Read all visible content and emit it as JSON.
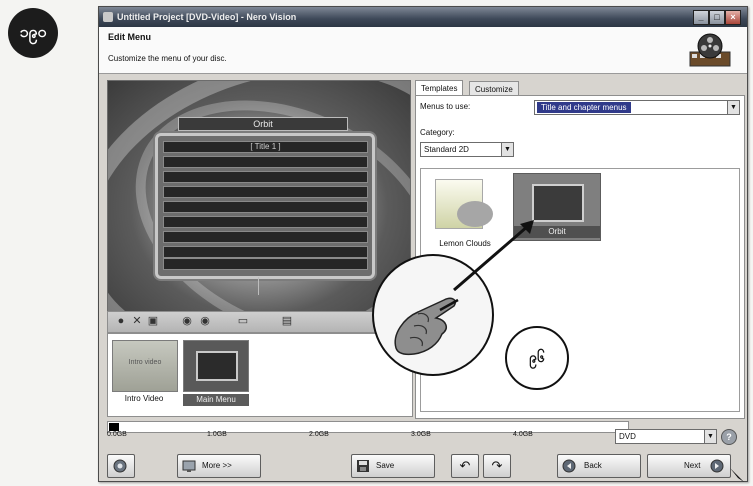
{
  "page_badge": "၁၉၀",
  "step_number": "၉၆",
  "window": {
    "title": "Untitled Project [DVD-Video] - Nero Vision",
    "minimize": "_",
    "maximize": "□",
    "close": "×"
  },
  "header": {
    "title": "Edit Menu",
    "subtitle": "Customize the menu of your disc."
  },
  "preview": {
    "menu_title": "Orbit",
    "first_item": "[ Title 1 ]",
    "row_count": 9
  },
  "toolbar_icons": [
    "circle-icon",
    "delete-icon",
    "save-icon",
    "play-icon",
    "stop-icon",
    "screen-icon",
    "layout-icon"
  ],
  "thumbnails": [
    {
      "label": "Intro Video",
      "inner_text": "Intro video"
    },
    {
      "label": "Main Menu",
      "inner_text": ""
    }
  ],
  "tabs": [
    {
      "label": "Templates",
      "active": true
    },
    {
      "label": "Customize",
      "active": false
    }
  ],
  "menus_to_use": {
    "label": "Menus to use:",
    "value": "Title and chapter menus"
  },
  "category": {
    "label": "Category:",
    "value": "Standard 2D"
  },
  "templates": [
    {
      "label": "Lemon Clouds",
      "selected": false
    },
    {
      "label": "Orbit",
      "selected": true
    }
  ],
  "capacity": {
    "ticks": [
      "0.0GB",
      "1.0GB",
      "2.0GB",
      "3.0GB",
      "4.0GB"
    ],
    "used_fraction": 0.02,
    "disc_type": "DVD",
    "help": "?"
  },
  "buttons": {
    "help": "",
    "more": "More >>",
    "save": "Save",
    "undo": "↶",
    "redo": "↷",
    "back": "Back",
    "next": "Next"
  }
}
